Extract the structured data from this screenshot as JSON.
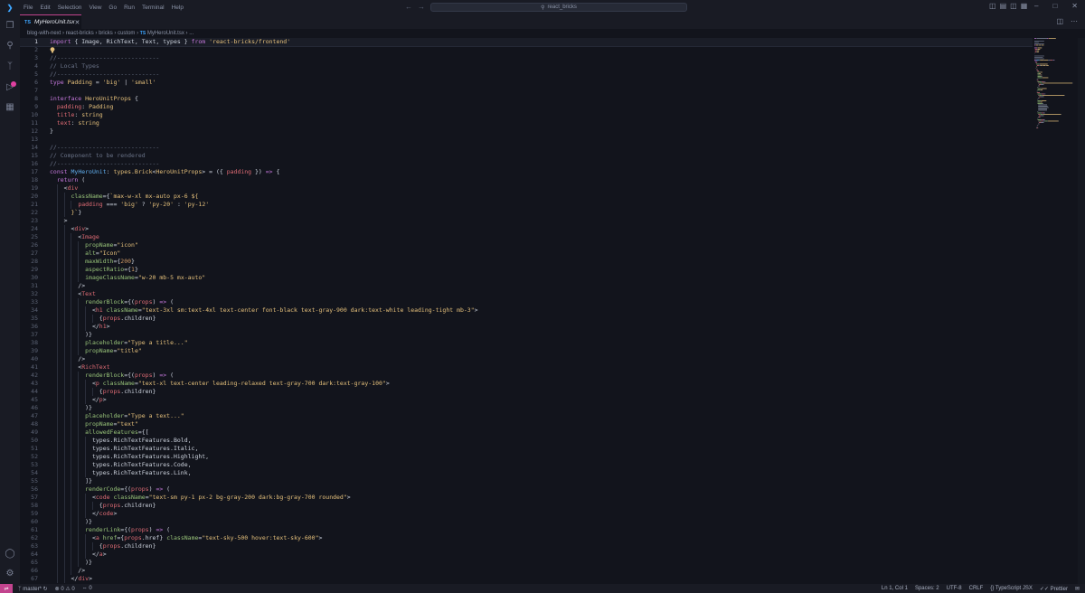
{
  "menu": [
    "File",
    "Edit",
    "Selection",
    "View",
    "Go",
    "Run",
    "Terminal",
    "Help"
  ],
  "search": {
    "text": "react_bricks"
  },
  "tab": {
    "lang": "TS",
    "title": "MyHeroUnit.tsx"
  },
  "breadcrumb": [
    "blog-with-next",
    "react-bricks",
    "bricks",
    "custom",
    "MyHeroUnit.tsx",
    "..."
  ],
  "breadcrumb_lang": "TS",
  "status": {
    "branch": "master*",
    "problems": "0 ⚠ 0",
    "ports": "0",
    "position": "Ln 1, Col 1",
    "spaces": "Spaces: 2",
    "encoding": "UTF-8",
    "eol": "CRLF",
    "language": "TypeScript JSX",
    "formatter": "Prettier"
  },
  "colors": {
    "accent": "#c2448e",
    "background": "#12141c",
    "chrome": "#191b24"
  },
  "icons": [
    "explorer-icon",
    "search-icon",
    "source-control-icon",
    "run-debug-icon",
    "extensions-icon",
    "account-icon",
    "settings-gear-icon",
    "lightbulb-icon",
    "close-icon"
  ],
  "code_lines": [
    [
      [
        "kw",
        "import"
      ],
      [
        "txt",
        " { Image, RichText, Text, types } "
      ],
      [
        "kw",
        "from"
      ],
      [
        "str",
        " 'react-bricks/frontend'"
      ]
    ],
    [],
    [
      [
        "cm",
        "//-----------------------------"
      ]
    ],
    [
      [
        "cm",
        "// Local Types"
      ]
    ],
    [
      [
        "cm",
        "//-----------------------------"
      ]
    ],
    [
      [
        "kw",
        "type"
      ],
      [
        "tp",
        " Padding"
      ],
      [
        "txt",
        " = "
      ],
      [
        "str",
        "'big'"
      ],
      [
        "txt",
        " | "
      ],
      [
        "str",
        "'small'"
      ]
    ],
    [],
    [
      [
        "kw",
        "interface"
      ],
      [
        "tp",
        " HeroUnitProps"
      ],
      [
        "txt",
        " {"
      ]
    ],
    [
      [
        "txt",
        "  "
      ],
      [
        "prop",
        "padding"
      ],
      [
        "txt",
        ": "
      ],
      [
        "tp",
        "Padding"
      ]
    ],
    [
      [
        "txt",
        "  "
      ],
      [
        "prop",
        "title"
      ],
      [
        "txt",
        ": "
      ],
      [
        "tp",
        "string"
      ]
    ],
    [
      [
        "txt",
        "  "
      ],
      [
        "prop",
        "text"
      ],
      [
        "txt",
        ": "
      ],
      [
        "tp",
        "string"
      ]
    ],
    [
      [
        "txt",
        "}"
      ]
    ],
    [],
    [
      [
        "cm",
        "//-----------------------------"
      ]
    ],
    [
      [
        "cm",
        "// Component to be rendered"
      ]
    ],
    [
      [
        "cm",
        "//-----------------------------"
      ]
    ],
    [
      [
        "kw",
        "const"
      ],
      [
        "fn",
        " MyHeroUnit"
      ],
      [
        "txt",
        ": "
      ],
      [
        "tp",
        "types.Brick"
      ],
      [
        "txt",
        "<"
      ],
      [
        "tp",
        "HeroUnitProps"
      ],
      [
        "txt",
        "> = ({ "
      ],
      [
        "prop",
        "padding"
      ],
      [
        "txt",
        " }) "
      ],
      [
        "kw",
        "=>"
      ],
      [
        "txt",
        " {"
      ]
    ],
    [
      [
        "txt",
        "  "
      ],
      [
        "kw",
        "return"
      ],
      [
        "txt",
        " ("
      ]
    ],
    [
      [
        "txt",
        "    <"
      ],
      [
        "tag",
        "div"
      ]
    ],
    [
      [
        "txt",
        "      "
      ],
      [
        "attr",
        "className"
      ],
      [
        "txt",
        "={"
      ],
      [
        "str",
        "`max-w-xl mx-auto px-6 "
      ],
      [
        "br",
        "${"
      ]
    ],
    [
      [
        "txt",
        "        "
      ],
      [
        "prop",
        "padding"
      ],
      [
        "txt",
        " === "
      ],
      [
        "str",
        "'big'"
      ],
      [
        "txt",
        " ? "
      ],
      [
        "str",
        "'py-20'"
      ],
      [
        "txt",
        " : "
      ],
      [
        "str",
        "'py-12'"
      ]
    ],
    [
      [
        "txt",
        "      "
      ],
      [
        "br",
        "}"
      ],
      [
        "str",
        "`"
      ],
      [
        "txt",
        "}"
      ]
    ],
    [
      [
        "txt",
        "    >"
      ]
    ],
    [
      [
        "txt",
        "      <"
      ],
      [
        "tag",
        "div"
      ],
      [
        "txt",
        ">"
      ]
    ],
    [
      [
        "txt",
        "        <"
      ],
      [
        "tag",
        "Image"
      ]
    ],
    [
      [
        "txt",
        "          "
      ],
      [
        "attr",
        "propName"
      ],
      [
        "txt",
        "="
      ],
      [
        "str",
        "\"icon\""
      ]
    ],
    [
      [
        "txt",
        "          "
      ],
      [
        "attr",
        "alt"
      ],
      [
        "txt",
        "="
      ],
      [
        "str",
        "\"Icon\""
      ]
    ],
    [
      [
        "txt",
        "          "
      ],
      [
        "attr",
        "maxWidth"
      ],
      [
        "txt",
        "={"
      ],
      [
        "num",
        "200"
      ],
      [
        "txt",
        "}"
      ]
    ],
    [
      [
        "txt",
        "          "
      ],
      [
        "attr",
        "aspectRatio"
      ],
      [
        "txt",
        "={"
      ],
      [
        "num",
        "1"
      ],
      [
        "txt",
        "}"
      ]
    ],
    [
      [
        "txt",
        "          "
      ],
      [
        "attr",
        "imageClassName"
      ],
      [
        "txt",
        "="
      ],
      [
        "str",
        "\"w-20 mb-5 mx-auto\""
      ]
    ],
    [
      [
        "txt",
        "        />"
      ]
    ],
    [
      [
        "txt",
        "        <"
      ],
      [
        "tag",
        "Text"
      ]
    ],
    [
      [
        "txt",
        "          "
      ],
      [
        "attr",
        "renderBlock"
      ],
      [
        "txt",
        "={("
      ],
      [
        "prop",
        "props"
      ],
      [
        "txt",
        ") "
      ],
      [
        "kw",
        "=>"
      ],
      [
        "txt",
        " ("
      ]
    ],
    [
      [
        "txt",
        "            <"
      ],
      [
        "tag",
        "h1"
      ],
      [
        "txt",
        " "
      ],
      [
        "attr",
        "className"
      ],
      [
        "txt",
        "="
      ],
      [
        "str",
        "\"text-3xl sm:text-4xl text-center font-black text-gray-900 dark:text-white leading-tight mb-3\""
      ],
      [
        "txt",
        ">"
      ]
    ],
    [
      [
        "txt",
        "              {"
      ],
      [
        "prop",
        "props"
      ],
      [
        "txt",
        ".children}"
      ]
    ],
    [
      [
        "txt",
        "            </"
      ],
      [
        "tag",
        "h1"
      ],
      [
        "txt",
        ">"
      ]
    ],
    [
      [
        "txt",
        "          )}"
      ]
    ],
    [
      [
        "txt",
        "          "
      ],
      [
        "attr",
        "placeholder"
      ],
      [
        "txt",
        "="
      ],
      [
        "str",
        "\"Type a title...\""
      ]
    ],
    [
      [
        "txt",
        "          "
      ],
      [
        "attr",
        "propName"
      ],
      [
        "txt",
        "="
      ],
      [
        "str",
        "\"title\""
      ]
    ],
    [
      [
        "txt",
        "        />"
      ]
    ],
    [
      [
        "txt",
        "        <"
      ],
      [
        "tag",
        "RichText"
      ]
    ],
    [
      [
        "txt",
        "          "
      ],
      [
        "attr",
        "renderBlock"
      ],
      [
        "txt",
        "={("
      ],
      [
        "prop",
        "props"
      ],
      [
        "txt",
        ") "
      ],
      [
        "kw",
        "=>"
      ],
      [
        "txt",
        " ("
      ]
    ],
    [
      [
        "txt",
        "            <"
      ],
      [
        "tag",
        "p"
      ],
      [
        "txt",
        " "
      ],
      [
        "attr",
        "className"
      ],
      [
        "txt",
        "="
      ],
      [
        "str",
        "\"text-xl text-center leading-relaxed text-gray-700 dark:text-gray-100\""
      ],
      [
        "txt",
        ">"
      ]
    ],
    [
      [
        "txt",
        "              {"
      ],
      [
        "prop",
        "props"
      ],
      [
        "txt",
        ".children}"
      ]
    ],
    [
      [
        "txt",
        "            </"
      ],
      [
        "tag",
        "p"
      ],
      [
        "txt",
        ">"
      ]
    ],
    [
      [
        "txt",
        "          )}"
      ]
    ],
    [
      [
        "txt",
        "          "
      ],
      [
        "attr",
        "placeholder"
      ],
      [
        "txt",
        "="
      ],
      [
        "str",
        "\"Type a text...\""
      ]
    ],
    [
      [
        "txt",
        "          "
      ],
      [
        "attr",
        "propName"
      ],
      [
        "txt",
        "="
      ],
      [
        "str",
        "\"text\""
      ]
    ],
    [
      [
        "txt",
        "          "
      ],
      [
        "attr",
        "allowedFeatures"
      ],
      [
        "txt",
        "={["
      ]
    ],
    [
      [
        "txt",
        "            types.RichTextFeatures.Bold,"
      ]
    ],
    [
      [
        "txt",
        "            types.RichTextFeatures.Italic,"
      ]
    ],
    [
      [
        "txt",
        "            types.RichTextFeatures.Highlight,"
      ]
    ],
    [
      [
        "txt",
        "            types.RichTextFeatures.Code,"
      ]
    ],
    [
      [
        "txt",
        "            types.RichTextFeatures.Link,"
      ]
    ],
    [
      [
        "txt",
        "          ]}"
      ]
    ],
    [
      [
        "txt",
        "          "
      ],
      [
        "attr",
        "renderCode"
      ],
      [
        "txt",
        "={("
      ],
      [
        "prop",
        "props"
      ],
      [
        "txt",
        ") "
      ],
      [
        "kw",
        "=>"
      ],
      [
        "txt",
        " ("
      ]
    ],
    [
      [
        "txt",
        "            <"
      ],
      [
        "tag",
        "code"
      ],
      [
        "txt",
        " "
      ],
      [
        "attr",
        "className"
      ],
      [
        "txt",
        "="
      ],
      [
        "str",
        "\"text-sm py-1 px-2 bg-gray-200 dark:bg-gray-700 rounded\""
      ],
      [
        "txt",
        ">"
      ]
    ],
    [
      [
        "txt",
        "              {"
      ],
      [
        "prop",
        "props"
      ],
      [
        "txt",
        ".children}"
      ]
    ],
    [
      [
        "txt",
        "            </"
      ],
      [
        "tag",
        "code"
      ],
      [
        "txt",
        ">"
      ]
    ],
    [
      [
        "txt",
        "          )}"
      ]
    ],
    [
      [
        "txt",
        "          "
      ],
      [
        "attr",
        "renderLink"
      ],
      [
        "txt",
        "={("
      ],
      [
        "prop",
        "props"
      ],
      [
        "txt",
        ") "
      ],
      [
        "kw",
        "=>"
      ],
      [
        "txt",
        " ("
      ]
    ],
    [
      [
        "txt",
        "            <"
      ],
      [
        "tag",
        "a"
      ],
      [
        "txt",
        " "
      ],
      [
        "attr",
        "href"
      ],
      [
        "txt",
        "={"
      ],
      [
        "prop",
        "props"
      ],
      [
        "txt",
        ".href} "
      ],
      [
        "attr",
        "className"
      ],
      [
        "txt",
        "="
      ],
      [
        "str",
        "\"text-sky-500 hover:text-sky-600\""
      ],
      [
        "txt",
        ">"
      ]
    ],
    [
      [
        "txt",
        "              {"
      ],
      [
        "prop",
        "props"
      ],
      [
        "txt",
        ".children}"
      ]
    ],
    [
      [
        "txt",
        "            </"
      ],
      [
        "tag",
        "a"
      ],
      [
        "txt",
        ">"
      ]
    ],
    [
      [
        "txt",
        "          )}"
      ]
    ],
    [
      [
        "txt",
        "        />"
      ]
    ],
    [
      [
        "txt",
        "      </"
      ],
      [
        "tag",
        "div"
      ],
      [
        "txt",
        ">"
      ]
    ]
  ]
}
